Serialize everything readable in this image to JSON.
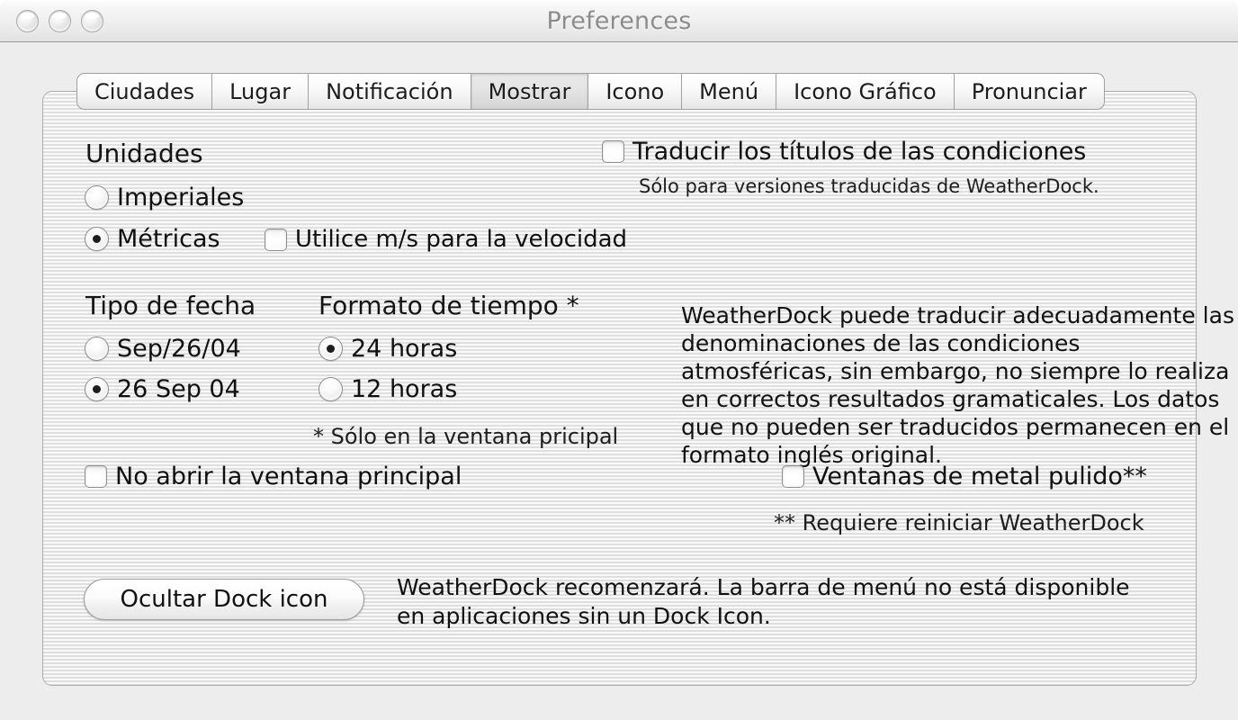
{
  "window": {
    "title": "Preferences",
    "traffic_lights": [
      "close-button",
      "minimize-button",
      "zoom-button"
    ]
  },
  "tabs": [
    {
      "label": "Ciudades",
      "selected": false
    },
    {
      "label": "Lugar",
      "selected": false
    },
    {
      "label": "Notificación",
      "selected": false
    },
    {
      "label": "Mostrar",
      "selected": true
    },
    {
      "label": "Icono",
      "selected": false
    },
    {
      "label": "Menú",
      "selected": false
    },
    {
      "label": "Icono Gráfico",
      "selected": false
    },
    {
      "label": "Pronunciar",
      "selected": false
    }
  ],
  "units": {
    "heading": "Unidades",
    "imperial_label": "Imperiales",
    "imperial_selected": false,
    "metric_label": "Métricas",
    "metric_selected": true,
    "ms_speed_label": "Utilice m/s para la velocidad",
    "ms_speed_checked": false
  },
  "date_format": {
    "heading": "Tipo de fecha",
    "option_a_label": "Sep/26/04",
    "option_a_selected": false,
    "option_b_label": "26 Sep 04",
    "option_b_selected": true
  },
  "time_format": {
    "heading": "Formato de tiempo *",
    "option_24_label": "24 horas",
    "option_24_selected": true,
    "option_12_label": "12 horas",
    "option_12_selected": false,
    "footnote": "* Sólo en la ventana pricipal"
  },
  "translate": {
    "checkbox_label": "Traducir los títulos de las condiciones",
    "checked": false,
    "subtitle": "Sólo para versiones traducidas de WeatherDock.",
    "paragraph": "WeatherDock puede traducir adecuadamente las denominaciones de las condiciones atmosféricas, sin embargo, no siempre lo realiza en correctos resultados gramaticales. Los datos que no pueden ser traducidos permanecen en el formato inglés original."
  },
  "main_window": {
    "no_open_label": "No abrir la ventana principal",
    "no_open_checked": false
  },
  "metal": {
    "label": "Ventanas de metal pulido**",
    "checked": false,
    "footnote": "** Requiere reiniciar WeatherDock"
  },
  "dock": {
    "button_label": "Ocultar Dock icon",
    "description": "WeatherDock recomenzará. La barra de menú no está disponible en aplicaciones sin un Dock Icon."
  }
}
